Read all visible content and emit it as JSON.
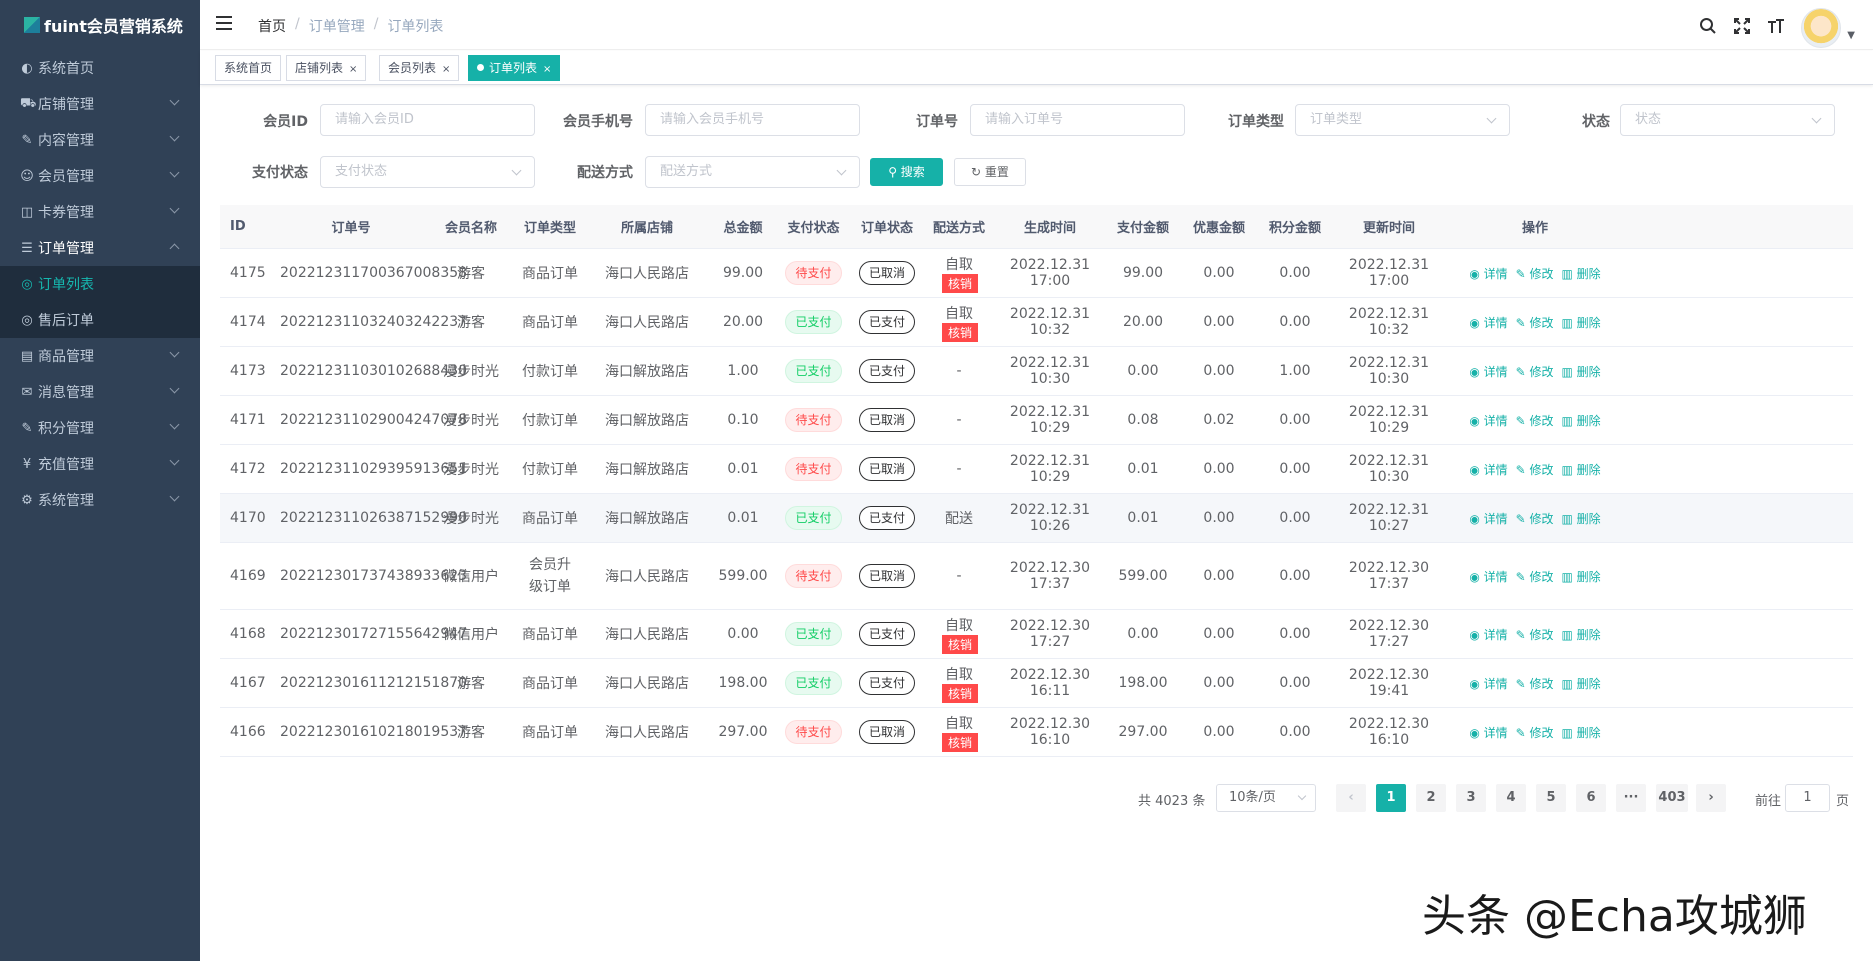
{
  "app": {
    "title": "fuint会员营销系统"
  },
  "sidebar": {
    "items": [
      {
        "label": "系统首页",
        "icon": "dashboard-icon",
        "glyph": "◐",
        "has_children": false
      },
      {
        "label": "店铺管理",
        "icon": "cart-icon",
        "glyph": "⛟",
        "has_children": true
      },
      {
        "label": "内容管理",
        "icon": "edit-icon",
        "glyph": "✎",
        "has_children": true
      },
      {
        "label": "会员管理",
        "icon": "user-icon",
        "glyph": "☺",
        "has_children": true
      },
      {
        "label": "卡券管理",
        "icon": "coupon-icon",
        "glyph": "◫",
        "has_children": true
      },
      {
        "label": "订单管理",
        "icon": "list-icon",
        "glyph": "☰",
        "has_children": true,
        "expanded": true
      },
      {
        "label": "订单列表",
        "icon": "circle-check-icon",
        "glyph": "◎",
        "sub": true,
        "active": true
      },
      {
        "label": "售后订单",
        "icon": "circle-check-icon",
        "glyph": "◎",
        "sub": true
      },
      {
        "label": "商品管理",
        "icon": "goods-icon",
        "glyph": "▤",
        "has_children": true
      },
      {
        "label": "消息管理",
        "icon": "message-icon",
        "glyph": "✉",
        "has_children": true
      },
      {
        "label": "积分管理",
        "icon": "points-icon",
        "glyph": "✎",
        "has_children": true
      },
      {
        "label": "充值管理",
        "icon": "yen-icon",
        "glyph": "¥",
        "has_children": true
      },
      {
        "label": "系统管理",
        "icon": "gear-icon",
        "glyph": "⚙",
        "has_children": true
      }
    ]
  },
  "breadcrumb": [
    "首页",
    "订单管理",
    "订单列表"
  ],
  "tags": [
    {
      "label": "系统首页",
      "closable": false
    },
    {
      "label": "店铺列表",
      "closable": true
    },
    {
      "label": "会员列表",
      "closable": true
    },
    {
      "label": "订单列表",
      "closable": true,
      "active": true
    }
  ],
  "filters": {
    "member_id": {
      "label": "会员ID",
      "placeholder": "请输入会员ID"
    },
    "mobile": {
      "label": "会员手机号",
      "placeholder": "请输入会员手机号"
    },
    "order_sn": {
      "label": "订单号",
      "placeholder": "请输入订单号"
    },
    "order_type": {
      "label": "订单类型",
      "placeholder": "订单类型"
    },
    "status": {
      "label": "状态",
      "placeholder": "状态"
    },
    "pay_status": {
      "label": "支付状态",
      "placeholder": "支付状态"
    },
    "delivery": {
      "label": "配送方式",
      "placeholder": "配送方式"
    },
    "search_label": "搜索",
    "reset_label": "重置"
  },
  "table": {
    "columns": [
      "ID",
      "订单号",
      "会员名称",
      "订单类型",
      "所属店铺",
      "总金额",
      "支付状态",
      "订单状态",
      "配送方式",
      "生成时间",
      "支付金额",
      "优惠金额",
      "积分金额",
      "更新时间",
      "操作"
    ],
    "rows": [
      {
        "id": "4175",
        "sn": "202212311700367008358",
        "member": "游客",
        "type": "商品订单",
        "store": "海口人民路店",
        "amount": "99.00",
        "pay_status": "待支付",
        "order_status": "已取消",
        "delivery": "自取",
        "verify": "核销",
        "created": "2022.12.31 17:00",
        "pay_amount": "99.00",
        "discount": "0.00",
        "points": "0.00",
        "updated": "2022.12.31 17:00"
      },
      {
        "id": "4174",
        "sn": "202212311032403242237",
        "member": "游客",
        "type": "商品订单",
        "store": "海口人民路店",
        "amount": "20.00",
        "pay_status": "已支付",
        "order_status": "已支付",
        "delivery": "自取",
        "verify": "核销",
        "created": "2022.12.31 10:32",
        "pay_amount": "20.00",
        "discount": "0.00",
        "points": "0.00",
        "updated": "2022.12.31 10:32"
      },
      {
        "id": "4173",
        "sn": "202212311030102688430",
        "member": "漫步时光",
        "type": "付款订单",
        "store": "海口解放路店",
        "amount": "1.00",
        "pay_status": "已支付",
        "order_status": "已支付",
        "delivery": "-",
        "verify": "",
        "created": "2022.12.31 10:30",
        "pay_amount": "0.00",
        "discount": "0.00",
        "points": "1.00",
        "updated": "2022.12.31 10:30"
      },
      {
        "id": "4171",
        "sn": "202212311029004247078",
        "member": "漫步时光",
        "type": "付款订单",
        "store": "海口解放路店",
        "amount": "0.10",
        "pay_status": "待支付",
        "order_status": "已取消",
        "delivery": "-",
        "verify": "",
        "created": "2022.12.31 10:29",
        "pay_amount": "0.08",
        "discount": "0.02",
        "points": "0.00",
        "updated": "2022.12.31 10:29"
      },
      {
        "id": "4172",
        "sn": "202212311029395913651",
        "member": "漫步时光",
        "type": "付款订单",
        "store": "海口解放路店",
        "amount": "0.01",
        "pay_status": "待支付",
        "order_status": "已取消",
        "delivery": "-",
        "verify": "",
        "created": "2022.12.31 10:29",
        "pay_amount": "0.01",
        "discount": "0.00",
        "points": "0.00",
        "updated": "2022.12.31 10:30"
      },
      {
        "id": "4170",
        "sn": "202212311026387152990",
        "member": "漫步时光",
        "type": "商品订单",
        "store": "海口解放路店",
        "amount": "0.01",
        "pay_status": "已支付",
        "order_status": "已支付",
        "delivery": "配送",
        "verify": "",
        "created": "2022.12.31 10:26",
        "pay_amount": "0.01",
        "discount": "0.00",
        "points": "0.00",
        "updated": "2022.12.31 10:27",
        "highlight": true
      },
      {
        "id": "4169",
        "sn": "202212301737438933623",
        "member": "微信用户",
        "type": "会员升级订单",
        "store": "海口人民路店",
        "amount": "599.00",
        "pay_status": "待支付",
        "order_status": "已取消",
        "delivery": "-",
        "verify": "",
        "created": "2022.12.30 17:37",
        "pay_amount": "599.00",
        "discount": "0.00",
        "points": "0.00",
        "updated": "2022.12.30 17:37",
        "tall": true
      },
      {
        "id": "4168",
        "sn": "202212301727155642947",
        "member": "微信用户",
        "type": "商品订单",
        "store": "海口人民路店",
        "amount": "0.00",
        "pay_status": "已支付",
        "order_status": "已支付",
        "delivery": "自取",
        "verify": "核销",
        "created": "2022.12.30 17:27",
        "pay_amount": "0.00",
        "discount": "0.00",
        "points": "0.00",
        "updated": "2022.12.30 17:27"
      },
      {
        "id": "4167",
        "sn": "202212301611212151870",
        "member": "游客",
        "type": "商品订单",
        "store": "海口人民路店",
        "amount": "198.00",
        "pay_status": "已支付",
        "order_status": "已支付",
        "delivery": "自取",
        "verify": "核销",
        "created": "2022.12.30 16:11",
        "pay_amount": "198.00",
        "discount": "0.00",
        "points": "0.00",
        "updated": "2022.12.30 19:41"
      },
      {
        "id": "4166",
        "sn": "202212301610218019537",
        "member": "游客",
        "type": "商品订单",
        "store": "海口人民路店",
        "amount": "297.00",
        "pay_status": "待支付",
        "order_status": "已取消",
        "delivery": "自取",
        "verify": "核销",
        "created": "2022.12.30 16:10",
        "pay_amount": "297.00",
        "discount": "0.00",
        "points": "0.00",
        "updated": "2022.12.30 16:10"
      }
    ],
    "actions": {
      "detail": "详情",
      "edit": "修改",
      "delete": "删除"
    }
  },
  "pagination": {
    "total_text": "共 4023 条",
    "page_size": "10条/页",
    "pages": [
      "1",
      "2",
      "3",
      "4",
      "5",
      "6",
      "···",
      "403"
    ],
    "current": "1",
    "goto_prefix": "前往",
    "goto_value": "1",
    "goto_suffix": "页",
    "prev": "‹",
    "next": "›"
  },
  "watermark": "头条 @Echa攻城狮",
  "colors": {
    "accent": "#16b1a8",
    "sidebar_bg": "#304156",
    "danger": "#ff4949",
    "success": "#13ce66"
  }
}
